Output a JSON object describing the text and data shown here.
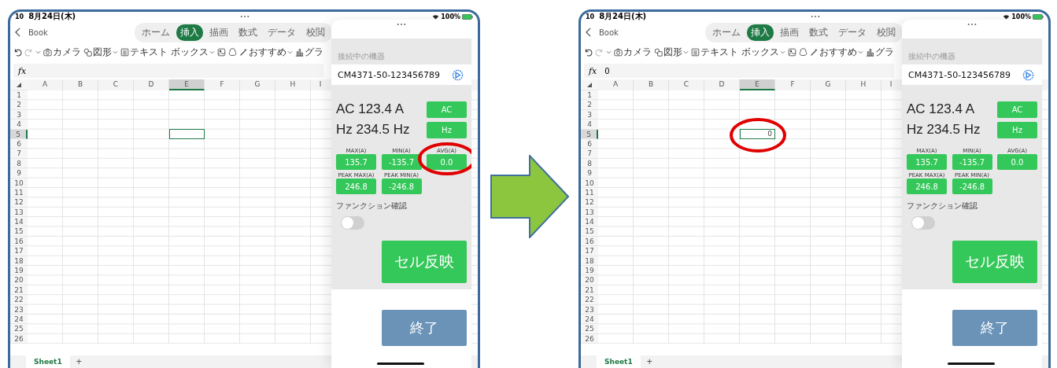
{
  "screens": [
    {
      "status_bar": {
        "time": "10",
        "date": "8月24日(木)",
        "battery": "100%"
      },
      "document_title": "Book",
      "ribbon_tabs": [
        {
          "label": "ホーム",
          "selected": false
        },
        {
          "label": "挿入",
          "selected": true
        },
        {
          "label": "描画",
          "selected": false
        },
        {
          "label": "数式",
          "selected": false
        },
        {
          "label": "データ",
          "selected": false
        },
        {
          "label": "校閲",
          "selected": false
        }
      ],
      "toolbar": [
        {
          "kind": "undo"
        },
        {
          "kind": "redo"
        },
        {
          "kind": "more"
        },
        {
          "kind": "camera",
          "label": "カメラ"
        },
        {
          "kind": "shapes",
          "label": "図形"
        },
        {
          "kind": "textbox",
          "label": "テキスト ボックス"
        },
        {
          "kind": "picture"
        },
        {
          "kind": "icons"
        },
        {
          "kind": "recommend",
          "label": "おすすめ"
        },
        {
          "kind": "chart",
          "label": "グラ"
        }
      ],
      "formula_label": "fx",
      "columns": [
        {
          "label": "A",
          "selected": false
        },
        {
          "label": "B",
          "selected": false
        },
        {
          "label": "C",
          "selected": false
        },
        {
          "label": "D",
          "selected": false
        },
        {
          "label": "E",
          "selected": true
        },
        {
          "label": "F",
          "selected": false
        },
        {
          "label": "G",
          "selected": false
        },
        {
          "label": "H",
          "selected": false
        },
        {
          "label": "I",
          "selected": false
        }
      ],
      "rows": [
        {
          "label": "1",
          "selected": false
        },
        {
          "label": "2",
          "selected": false
        },
        {
          "label": "3",
          "selected": false
        },
        {
          "label": "4",
          "selected": false
        },
        {
          "label": "5",
          "selected": true
        },
        {
          "label": "6",
          "selected": false
        },
        {
          "label": "7",
          "selected": false
        },
        {
          "label": "8",
          "selected": false
        },
        {
          "label": "9",
          "selected": false
        },
        {
          "label": "10",
          "selected": false
        },
        {
          "label": "11",
          "selected": false
        },
        {
          "label": "12",
          "selected": false
        },
        {
          "label": "13",
          "selected": false
        },
        {
          "label": "14",
          "selected": false
        },
        {
          "label": "15",
          "selected": false
        },
        {
          "label": "16",
          "selected": false
        },
        {
          "label": "17",
          "selected": false
        },
        {
          "label": "18",
          "selected": false
        },
        {
          "label": "19",
          "selected": false
        },
        {
          "label": "20",
          "selected": false
        },
        {
          "label": "21",
          "selected": false
        },
        {
          "label": "22",
          "selected": false
        },
        {
          "label": "23",
          "selected": false
        },
        {
          "label": "24",
          "selected": false
        },
        {
          "label": "25",
          "selected": false
        },
        {
          "label": "26",
          "selected": false
        }
      ],
      "cell_highlighted": false,
      "sheets": [
        {
          "label": "Sheet1",
          "selected": true
        }
      ],
      "add_sheet": "+",
      "panel": {
        "section_label": "接続中の機器",
        "device": "CM4371-50-123456789",
        "readings": [
          {
            "text": "AC 123.4 A",
            "button": "AC"
          },
          {
            "text": "Hz 234.5 Hz",
            "button": "Hz"
          }
        ],
        "stats": [
          {
            "label": "MAX(A)",
            "value": "135.7",
            "highlighted": false
          },
          {
            "label": "MIN(A)",
            "value": "-135.7",
            "highlighted": false
          },
          {
            "label": "AVG(A)",
            "value": "0.0",
            "highlighted": true
          },
          {
            "label": "PEAK MAX(A)",
            "value": "246.8",
            "highlighted": false
          },
          {
            "label": "PEAK MIN(A)",
            "value": "-246.8",
            "highlighted": false
          }
        ],
        "function_check": {
          "label": "ファンクション確認",
          "on": false
        },
        "apply_button": "セル反映",
        "exit_button": "終了"
      }
    },
    {
      "status_bar": {
        "time": "10",
        "date": "8月24日(木)",
        "battery": "100%"
      },
      "document_title": "Book",
      "ribbon_tabs": [
        {
          "label": "ホーム",
          "selected": false
        },
        {
          "label": "挿入",
          "selected": true
        },
        {
          "label": "描画",
          "selected": false
        },
        {
          "label": "数式",
          "selected": false
        },
        {
          "label": "データ",
          "selected": false
        },
        {
          "label": "校閲",
          "selected": false
        }
      ],
      "toolbar": [
        {
          "kind": "undo"
        },
        {
          "kind": "redo"
        },
        {
          "kind": "more"
        },
        {
          "kind": "camera",
          "label": "カメラ"
        },
        {
          "kind": "shapes",
          "label": "図形"
        },
        {
          "kind": "textbox",
          "label": "テキスト ボックス"
        },
        {
          "kind": "picture"
        },
        {
          "kind": "icons"
        },
        {
          "kind": "recommend",
          "label": "おすすめ"
        },
        {
          "kind": "chart",
          "label": "グラ"
        }
      ],
      "formula_label": "fx",
      "formula": "0",
      "columns": [
        {
          "label": "A",
          "selected": false
        },
        {
          "label": "B",
          "selected": false
        },
        {
          "label": "C",
          "selected": false
        },
        {
          "label": "D",
          "selected": false
        },
        {
          "label": "E",
          "selected": true
        },
        {
          "label": "F",
          "selected": false
        },
        {
          "label": "G",
          "selected": false
        },
        {
          "label": "H",
          "selected": false
        },
        {
          "label": "I",
          "selected": false
        }
      ],
      "rows": [
        {
          "label": "1",
          "selected": false
        },
        {
          "label": "2",
          "selected": false
        },
        {
          "label": "3",
          "selected": false
        },
        {
          "label": "4",
          "selected": false
        },
        {
          "label": "5",
          "selected": true
        },
        {
          "label": "6",
          "selected": false
        },
        {
          "label": "7",
          "selected": false
        },
        {
          "label": "8",
          "selected": false
        },
        {
          "label": "9",
          "selected": false
        },
        {
          "label": "10",
          "selected": false
        },
        {
          "label": "11",
          "selected": false
        },
        {
          "label": "12",
          "selected": false
        },
        {
          "label": "13",
          "selected": false
        },
        {
          "label": "14",
          "selected": false
        },
        {
          "label": "15",
          "selected": false
        },
        {
          "label": "16",
          "selected": false
        },
        {
          "label": "17",
          "selected": false
        },
        {
          "label": "18",
          "selected": false
        },
        {
          "label": "19",
          "selected": false
        },
        {
          "label": "20",
          "selected": false
        },
        {
          "label": "21",
          "selected": false
        },
        {
          "label": "22",
          "selected": false
        },
        {
          "label": "23",
          "selected": false
        },
        {
          "label": "24",
          "selected": false
        },
        {
          "label": "25",
          "selected": false
        },
        {
          "label": "26",
          "selected": false
        }
      ],
      "cell_value": "0",
      "cell_highlighted": true,
      "sheets": [
        {
          "label": "Sheet1",
          "selected": true
        }
      ],
      "add_sheet": "+",
      "panel": {
        "section_label": "接続中の機器",
        "device": "CM4371-50-123456789",
        "readings": [
          {
            "text": "AC 123.4 A",
            "button": "AC"
          },
          {
            "text": "Hz 234.5 Hz",
            "button": "Hz"
          }
        ],
        "stats": [
          {
            "label": "MAX(A)",
            "value": "135.7",
            "highlighted": false
          },
          {
            "label": "MIN(A)",
            "value": "-135.7",
            "highlighted": false
          },
          {
            "label": "AVG(A)",
            "value": "0.0",
            "highlighted": false
          },
          {
            "label": "PEAK MAX(A)",
            "value": "246.8",
            "highlighted": false
          },
          {
            "label": "PEAK MIN(A)",
            "value": "-246.8",
            "highlighted": false
          }
        ],
        "function_check": {
          "label": "ファンクション確認",
          "on": false
        },
        "apply_button": "セル反映",
        "exit_button": "終了"
      }
    }
  ]
}
